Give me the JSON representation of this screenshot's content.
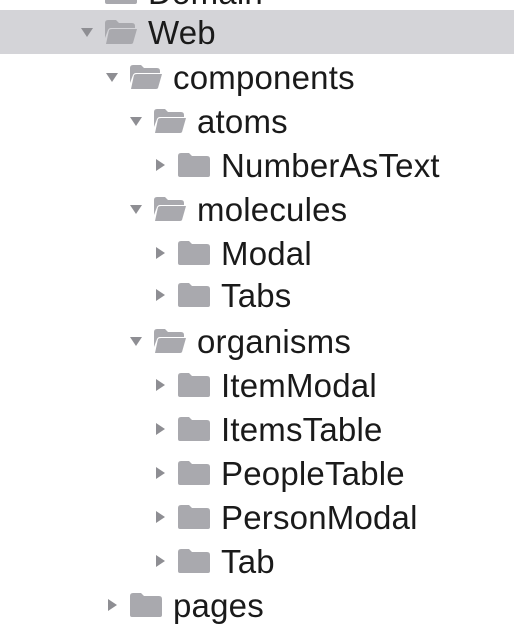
{
  "tree": {
    "items": [
      {
        "label": "Domain",
        "expanded": false,
        "open_icon": false,
        "selected": false,
        "clipped": true
      },
      {
        "label": "Web",
        "expanded": true,
        "open_icon": true,
        "selected": true
      },
      {
        "label": "components",
        "expanded": true,
        "open_icon": true
      },
      {
        "label": "atoms",
        "expanded": true,
        "open_icon": true
      },
      {
        "label": "NumberAsText",
        "expanded": false,
        "open_icon": false
      },
      {
        "label": "molecules",
        "expanded": true,
        "open_icon": true
      },
      {
        "label": "Modal",
        "expanded": false,
        "open_icon": false
      },
      {
        "label": "Tabs",
        "expanded": false,
        "open_icon": false
      },
      {
        "label": "organisms",
        "expanded": true,
        "open_icon": true
      },
      {
        "label": "ItemModal",
        "expanded": false,
        "open_icon": false
      },
      {
        "label": "ItemsTable",
        "expanded": false,
        "open_icon": false
      },
      {
        "label": "PeopleTable",
        "expanded": false,
        "open_icon": false
      },
      {
        "label": "PersonModal",
        "expanded": false,
        "open_icon": false
      },
      {
        "label": "Tab",
        "expanded": false,
        "open_icon": false
      },
      {
        "label": "pages",
        "expanded": false,
        "open_icon": false
      }
    ]
  },
  "colors": {
    "selection": "#d4d4d8",
    "folder": "#a9a9ae",
    "disclosure": "#8e8e93",
    "text": "#1a1a1a"
  }
}
